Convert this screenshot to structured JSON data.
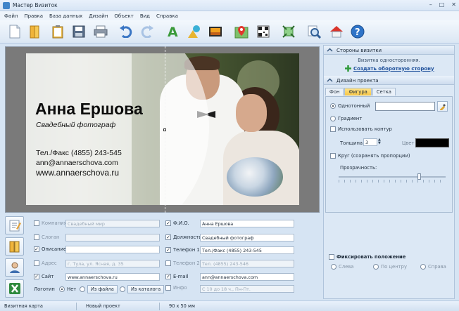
{
  "window": {
    "title": "Мастер Визиток",
    "controls": [
      "–",
      "□",
      "✕"
    ]
  },
  "menu": [
    "Файл",
    "Правка",
    "База данных",
    "Дизайн",
    "Объект",
    "Вид",
    "Справка"
  ],
  "toolbar": {
    "buttons": [
      "new-document",
      "open-folder",
      "templates",
      "save",
      "print",
      "undo",
      "redo",
      "add-text",
      "add-shape",
      "add-image",
      "add-map",
      "qr-code",
      "fit",
      "zoom",
      "publish",
      "help"
    ]
  },
  "card": {
    "name": "Анна Ершова",
    "slogan": "Свадебный фотограф",
    "phone": "Тел./Факс (4855) 243-545",
    "email": "ann@annaerschova.com",
    "site": "www.annaerschova.ru"
  },
  "fields": {
    "company": {
      "label": "Компания",
      "value": "Свадебный мир",
      "checked": false
    },
    "slogan": {
      "label": "Слоган",
      "value": "",
      "checked": false
    },
    "description": {
      "label": "Описание",
      "value": "",
      "checked": true
    },
    "address": {
      "label": "Адрес",
      "value": "г. Тула, ул. Ясная, д. 35",
      "checked": false
    },
    "site": {
      "label": "Сайт",
      "value": "www.annaerschova.ru",
      "checked": true
    },
    "logo": {
      "label": "Логотип",
      "options": [
        "Нет",
        "Из файла",
        "Из каталога"
      ],
      "selected": "Нет"
    },
    "fio": {
      "label": "Ф.И.О.",
      "value": "Анна Ершова",
      "checked": true
    },
    "position": {
      "label": "Должность",
      "value": "Свадебный фотограф",
      "checked": true
    },
    "phone1": {
      "label": "Телефон 1",
      "value": "Тел./Факс (4855) 243-545",
      "checked": true
    },
    "phone2": {
      "label": "Телефон 2",
      "value": "Тел. (4855) 243-546",
      "checked": false
    },
    "email": {
      "label": "E-mail",
      "value": "ann@annaerschova.com",
      "checked": true
    },
    "info": {
      "label": "Инфо",
      "value": "С 10 до 18 ч., Пн-Пт.",
      "checked": false
    }
  },
  "right_panel": {
    "sides_title": "Стороны визитки",
    "sides_note": "Визитка односторонняя.",
    "create_back_link": "Создать оборотную сторону",
    "design_title": "Дизайн проекта",
    "tabs": [
      "Фон",
      "Фигура",
      "Сетка"
    ],
    "active_tab": "Фигура",
    "solid_label": "Однотонный",
    "gradient_label": "Градиент",
    "use_outline_label": "Использовать контур",
    "thickness_label": "Толщина",
    "thickness_value": "3",
    "color_label": "Цвет",
    "circle_label": "Круг (сохранять пропорции)",
    "transparency_label": "Прозрачность:",
    "fix_position_label": "Фиксировать положение",
    "align_options": [
      "Слева",
      "По центру",
      "Справа"
    ],
    "fill_color": "#ffffff",
    "outline_color": "#000000",
    "transparency_level": 0.75
  },
  "status": {
    "doc_type": "Визитная карта",
    "project": "Новый проект",
    "size": "90 x 50 мм"
  }
}
